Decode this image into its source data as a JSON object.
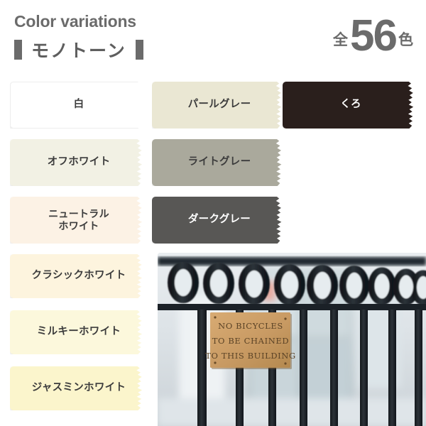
{
  "header": {
    "title_en": "Color variations",
    "subtitle_jp": "モノトーン",
    "count_prefix": "全",
    "count_number": "56",
    "count_suffix": "色",
    "accent_color": "#6b6b6b"
  },
  "swatches": [
    {
      "name": "白",
      "bg": "#ffffff",
      "text": "#3c3c3c",
      "col": 0,
      "row": 0,
      "lines": 1
    },
    {
      "name": "オフホワイト",
      "bg": "#f2f1e4",
      "text": "#3c3c3c",
      "col": 0,
      "row": 1,
      "lines": 1
    },
    {
      "name": "ニュートラル\nホワイト",
      "bg": "#fcf2e5",
      "text": "#3c3c3c",
      "col": 0,
      "row": 2,
      "lines": 2
    },
    {
      "name": "クラシックホワイト",
      "bg": "#fdf4de",
      "text": "#3c3c3c",
      "col": 0,
      "row": 3,
      "lines": 1
    },
    {
      "name": "ミルキーホワイト",
      "bg": "#fcf8dc",
      "text": "#3c3c3c",
      "col": 0,
      "row": 4,
      "lines": 1
    },
    {
      "name": "ジャスミンホワイト",
      "bg": "#fbf5cc",
      "text": "#3c3c3c",
      "col": 0,
      "row": 5,
      "lines": 1
    },
    {
      "name": "パールグレー",
      "bg": "#eae7d3",
      "text": "#3c3c3c",
      "col": 1,
      "row": 0,
      "lines": 1
    },
    {
      "name": "ライトグレー",
      "bg": "#aaa99c",
      "text": "#3c3c3c",
      "col": 1,
      "row": 1,
      "lines": 1
    },
    {
      "name": "ダークグレー",
      "bg": "#585755",
      "text": "#ffffff",
      "col": 1,
      "row": 2,
      "lines": 1
    },
    {
      "name": "くろ",
      "bg": "#2a1f1c",
      "text": "#ffffff",
      "col": 2,
      "row": 0,
      "lines": 1
    }
  ],
  "photo": {
    "alt": "黒い鉄柵とレンガ色の真鍮プレート",
    "plaque_line_1": "NO BICYCLES",
    "plaque_line_2": "TO BE CHAINED",
    "plaque_line_3": "TO THIS BUILDING",
    "plaque_color": "#c79a63",
    "fence_color": "#21262b",
    "background_color": "#d2d8dc"
  }
}
